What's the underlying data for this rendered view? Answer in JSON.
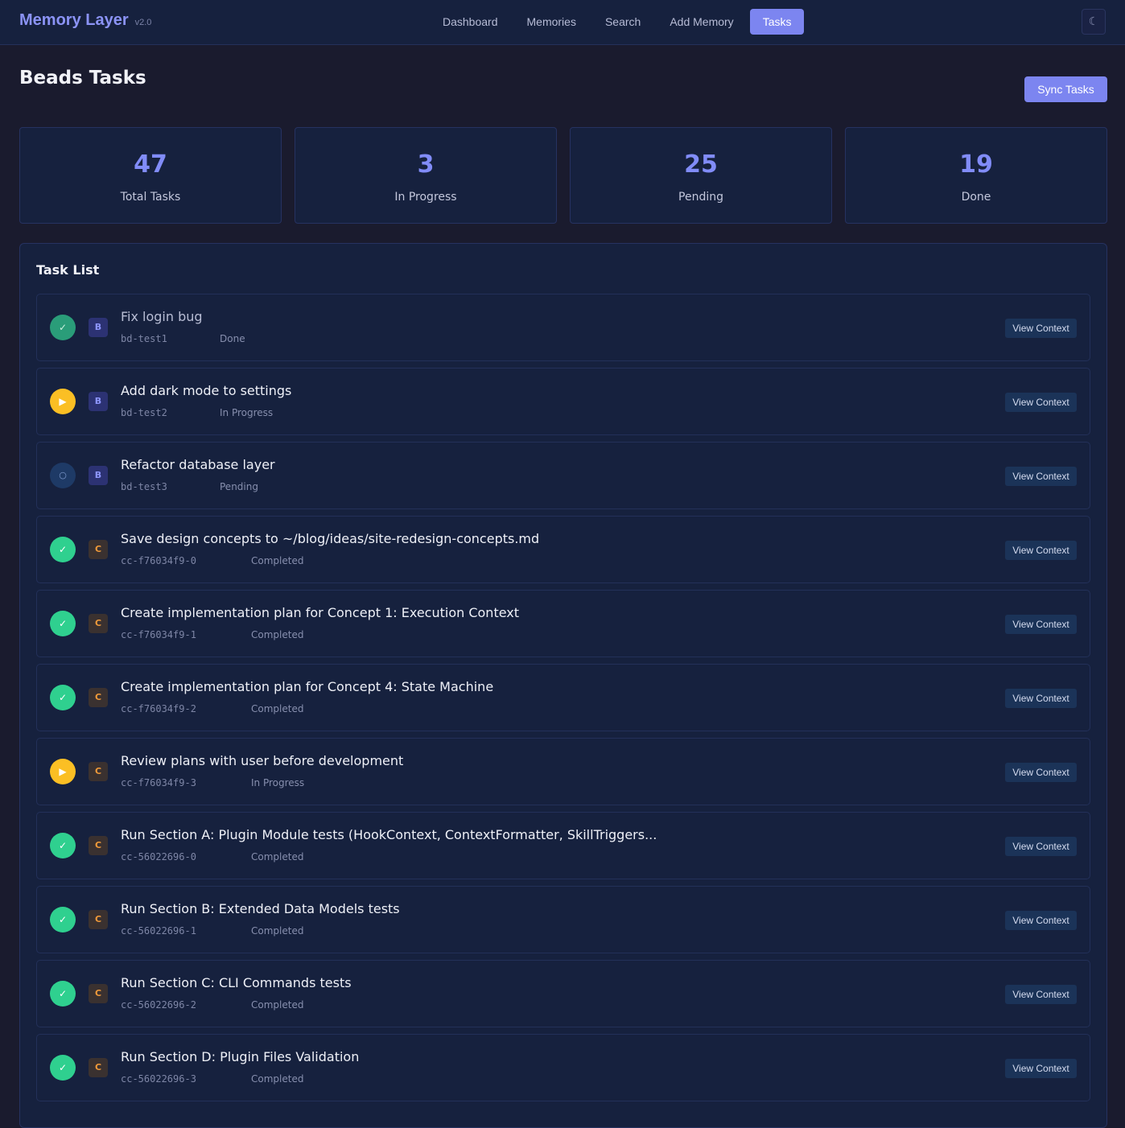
{
  "app": {
    "title": "Memory Layer",
    "version": "v2.0"
  },
  "nav": {
    "links": [
      "Dashboard",
      "Memories",
      "Search",
      "Add Memory",
      "Tasks"
    ],
    "active": "Tasks",
    "theme_icon": "moon-icon"
  },
  "page": {
    "title": "Beads Tasks",
    "sync_label": "Sync Tasks"
  },
  "stats": [
    {
      "value": "47",
      "label": "Total Tasks"
    },
    {
      "value": "3",
      "label": "In Progress"
    },
    {
      "value": "25",
      "label": "Pending"
    },
    {
      "value": "19",
      "label": "Done"
    }
  ],
  "task_list": {
    "title": "Task List",
    "view_label": "View Context",
    "tasks": [
      {
        "title": "Fix login bug",
        "id": "bd-test1",
        "status": "Done",
        "source": "B",
        "state": "done-dim"
      },
      {
        "title": "Add dark mode to settings",
        "id": "bd-test2",
        "status": "In Progress",
        "source": "B",
        "state": "progress"
      },
      {
        "title": "Refactor database layer",
        "id": "bd-test3",
        "status": "Pending",
        "source": "B",
        "state": "pending"
      },
      {
        "title": "Save design concepts to ~/blog/ideas/site-redesign-concepts.md",
        "id": "cc-f76034f9-0",
        "status": "Completed",
        "source": "C",
        "state": "done"
      },
      {
        "title": "Create implementation plan for Concept 1: Execution Context",
        "id": "cc-f76034f9-1",
        "status": "Completed",
        "source": "C",
        "state": "done"
      },
      {
        "title": "Create implementation plan for Concept 4: State Machine",
        "id": "cc-f76034f9-2",
        "status": "Completed",
        "source": "C",
        "state": "done"
      },
      {
        "title": "Review plans with user before development",
        "id": "cc-f76034f9-3",
        "status": "In Progress",
        "source": "C",
        "state": "progress"
      },
      {
        "title": "Run Section A: Plugin Module tests (HookContext, ContextFormatter, SkillTriggers...",
        "id": "cc-56022696-0",
        "status": "Completed",
        "source": "C",
        "state": "done"
      },
      {
        "title": "Run Section B: Extended Data Models tests",
        "id": "cc-56022696-1",
        "status": "Completed",
        "source": "C",
        "state": "done"
      },
      {
        "title": "Run Section C: CLI Commands tests",
        "id": "cc-56022696-2",
        "status": "Completed",
        "source": "C",
        "state": "done"
      },
      {
        "title": "Run Section D: Plugin Files Validation",
        "id": "cc-56022696-3",
        "status": "Completed",
        "source": "C",
        "state": "done"
      }
    ]
  }
}
